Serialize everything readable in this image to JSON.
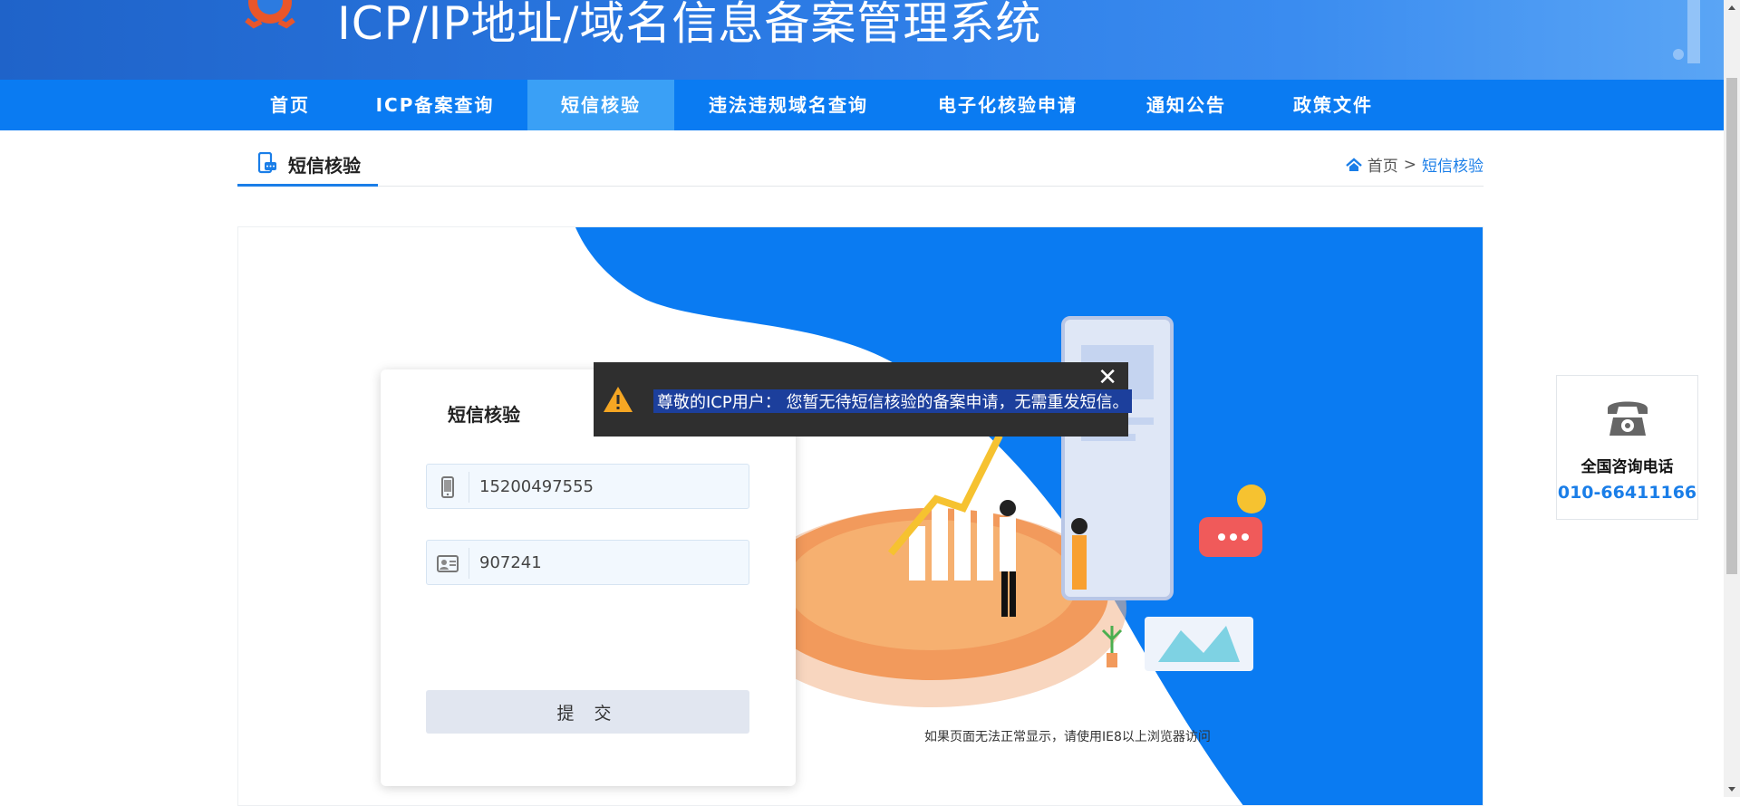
{
  "header": {
    "title": "ICP/IP地址/域名信息备案管理系统"
  },
  "nav": {
    "items": [
      {
        "label": "首页"
      },
      {
        "label": "ICP备案查询"
      },
      {
        "label": "短信核验"
      },
      {
        "label": "违法违规域名查询"
      },
      {
        "label": "电子化核验申请"
      },
      {
        "label": "通知公告"
      },
      {
        "label": "政策文件"
      }
    ],
    "active": "短信核验"
  },
  "subhead": {
    "title": "短信核验",
    "breadcrumb": {
      "home": "首页",
      "separator": ">",
      "current": "短信核验"
    }
  },
  "form": {
    "title": "短信核验",
    "phone_value": "15200497555",
    "code_value": "907241",
    "submit_label": "提 交"
  },
  "toast": {
    "message": "尊敬的ICP用户： 您暂无待短信核验的备案申请，无需重发短信。",
    "close_symbol": "✕"
  },
  "note": "如果页面无法正常显示，请使用IE8以上浏览器访问",
  "contact": {
    "label": "全国咨询电话",
    "number": "010-66411166"
  },
  "colors": {
    "brand_blue": "#0a7bf2",
    "nav_active": "#3aa0f6",
    "toast_bg": "#2f2f2f",
    "link_blue": "#1a7ee8"
  }
}
